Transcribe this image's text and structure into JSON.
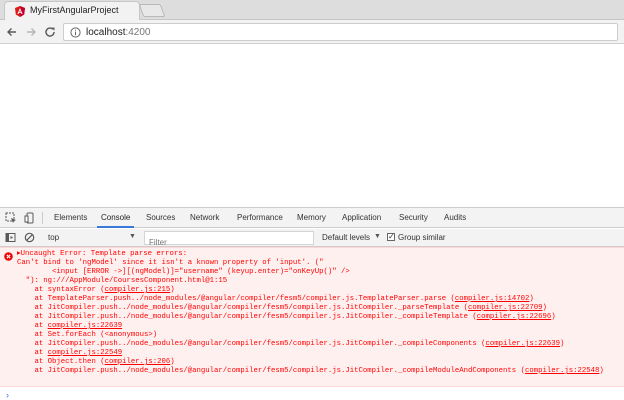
{
  "browser": {
    "tab_title": "MyFirstAngularProject",
    "url_host": "localhost",
    "url_port": ":4200"
  },
  "devtools": {
    "tabs": [
      "Elements",
      "Console",
      "Sources",
      "Network",
      "Performance",
      "Memory",
      "Application",
      "Security",
      "Audits"
    ],
    "active_tab": "Console",
    "context": "top",
    "filter_placeholder": "Filter",
    "levels": "Default levels",
    "group_similar": "Group similar",
    "group_similar_checked": true
  },
  "console": {
    "error": {
      "title": "Uncaught Error: Template parse errors:",
      "line2": "Can't bind to 'ngModel' since it isn't a known property of 'input'. (\"",
      "line3": "        <input [ERROR ->][(ngModel)]=\"username\" (keyup.enter)=\"onKeyUp()\" />",
      "line4": "  \"): ng:///AppModule/CoursesComponent.html@1:15",
      "stack": [
        {
          "prefix": "    at syntaxError (",
          "link": "compiler.js:215",
          "suffix": ")"
        },
        {
          "prefix": "    at TemplateParser.push../node_modules/@angular/compiler/fesm5/compiler.js.TemplateParser.parse (",
          "link": "compiler.js:14702",
          "suffix": ")"
        },
        {
          "prefix": "    at JitCompiler.push../node_modules/@angular/compiler/fesm5/compiler.js.JitCompiler._parseTemplate (",
          "link": "compiler.js:22709",
          "suffix": ")"
        },
        {
          "prefix": "    at JitCompiler.push../node_modules/@angular/compiler/fesm5/compiler.js.JitCompiler._compileTemplate (",
          "link": "compiler.js:22696",
          "suffix": ")"
        },
        {
          "prefix": "    at ",
          "link": "compiler.js:22639",
          "suffix": ""
        },
        {
          "prefix": "    at Set.forEach (<anonymous>)",
          "link": "",
          "suffix": ""
        },
        {
          "prefix": "    at JitCompiler.push../node_modules/@angular/compiler/fesm5/compiler.js.JitCompiler._compileComponents (",
          "link": "compiler.js:22639",
          "suffix": ")"
        },
        {
          "prefix": "    at ",
          "link": "compiler.js:22549",
          "suffix": ""
        },
        {
          "prefix": "    at Object.then (",
          "link": "compiler.js:206",
          "suffix": ")"
        },
        {
          "prefix": "    at JitCompiler.push../node_modules/@angular/compiler/fesm5/compiler.js.JitCompiler._compileModuleAndComponents (",
          "link": "compiler.js:22548",
          "suffix": ")"
        }
      ]
    },
    "prompt": "›"
  },
  "colors": {
    "error_text": "#ff0000",
    "error_bg": "#fff0f0",
    "angular_red": "#dd1b16",
    "devtools_accent": "#3879d9"
  },
  "icons": {
    "favicon": "angular-logo-icon",
    "back": "back-arrow-icon",
    "forward": "forward-arrow-icon",
    "reload": "reload-icon",
    "info": "info-icon",
    "inspect": "inspect-element-icon",
    "device": "device-toolbar-icon",
    "sidebar": "console-sidebar-icon",
    "clear": "clear-console-icon",
    "error": "error-circle-icon"
  }
}
